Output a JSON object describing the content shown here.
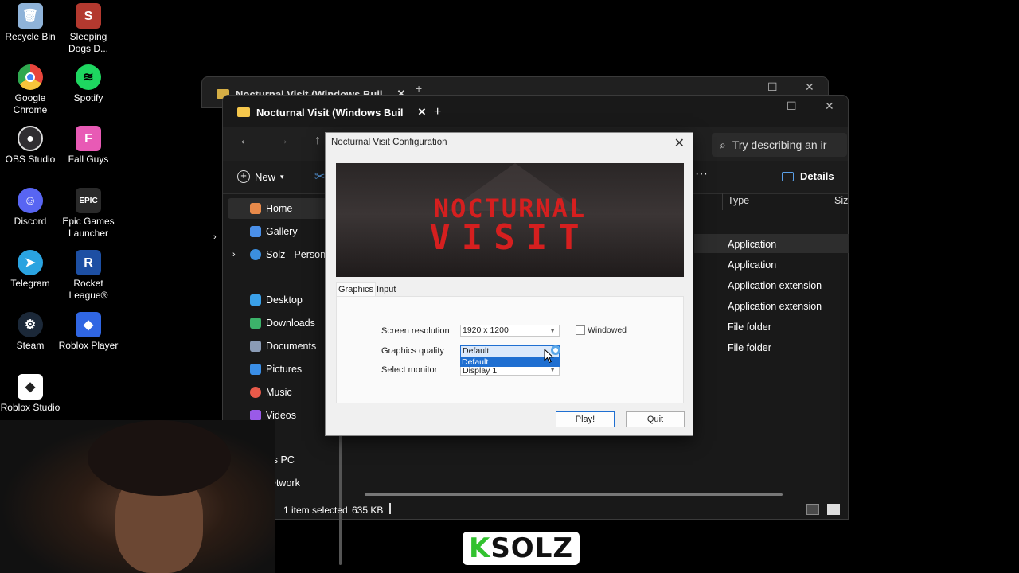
{
  "desktop": {
    "icons": [
      {
        "label": "Recycle Bin",
        "icon": "recycle-bin-icon",
        "color": "#8fb3d9"
      },
      {
        "label": "Sleeping Dogs D...",
        "icon": "sleeping-dogs-icon",
        "color": "#b3392f"
      },
      {
        "label": "Google Chrome",
        "icon": "chrome-icon",
        "color": "#e8453c"
      },
      {
        "label": "Spotify",
        "icon": "spotify-icon",
        "color": "#1ed760"
      },
      {
        "label": "OBS Studio",
        "icon": "obs-icon",
        "color": "#302e31"
      },
      {
        "label": "Fall Guys",
        "icon": "fall-guys-icon",
        "color": "#e85ab5"
      },
      {
        "label": "Discord",
        "icon": "discord-icon",
        "color": "#5865f2"
      },
      {
        "label": "Epic Games Launcher",
        "icon": "epic-games-icon",
        "color": "#2a2a2a"
      },
      {
        "label": "Telegram",
        "icon": "telegram-icon",
        "color": "#2aa3e0"
      },
      {
        "label": "Rocket League®",
        "icon": "rocket-league-icon",
        "color": "#1d4fa3"
      },
      {
        "label": "Steam",
        "icon": "steam-icon",
        "color": "#1b2838"
      },
      {
        "label": "Roblox Player",
        "icon": "roblox-player-icon",
        "color": "#3066e3"
      },
      {
        "label": "Roblox Studio",
        "icon": "roblox-studio-icon",
        "color": "#2f2f2f"
      }
    ]
  },
  "explorer": {
    "tab_title": "Nocturnal Visit (Windows Buil",
    "tab_close": "✕",
    "new_tab": "+",
    "controls": {
      "minimize": "—",
      "maximize": "☐",
      "close": "✕"
    },
    "nav": {
      "back": "←",
      "forward": "→",
      "up": "↑"
    },
    "search_placeholder": "Try describing an ir",
    "toolbar": {
      "new_label": "New",
      "details_label": "Details",
      "more": "···"
    },
    "sidebar": [
      {
        "label": "Home",
        "icon": "home-icon",
        "color": "#e88a4a"
      },
      {
        "label": "Gallery",
        "icon": "gallery-icon",
        "color": "#4a8fe8"
      },
      {
        "label": "Solz - Persona",
        "icon": "onedrive-icon",
        "color": "#3b8fe0"
      },
      {
        "label": "Desktop",
        "icon": "desktop-icon",
        "color": "#3aa0e8"
      },
      {
        "label": "Downloads",
        "icon": "downloads-icon",
        "color": "#3cb36a"
      },
      {
        "label": "Documents",
        "icon": "documents-icon",
        "color": "#8a9bb5"
      },
      {
        "label": "Pictures",
        "icon": "pictures-icon",
        "color": "#3a8ee6"
      },
      {
        "label": "Music",
        "icon": "music-icon",
        "color": "#e85a4a"
      },
      {
        "label": "Videos",
        "icon": "videos-icon",
        "color": "#9a5ae8"
      },
      {
        "label": "is PC",
        "icon": "pc-icon",
        "color": "#5aa0e8"
      },
      {
        "label": "etwork",
        "icon": "network-icon",
        "color": "#5aa0e8"
      }
    ],
    "columns": {
      "type": "Type",
      "size": "Siz"
    },
    "types": [
      "Application",
      "Application",
      "Application extension",
      "Application extension",
      "File folder",
      "File folder"
    ],
    "status": {
      "selected": "1 item selected",
      "size": "635 KB"
    }
  },
  "dialog": {
    "title": "Nocturnal Visit Configuration",
    "close": "✕",
    "banner": {
      "word1": "NOCTURNAL",
      "word2": "VISIT"
    },
    "tabs": {
      "graphics": "Graphics",
      "input": "Input"
    },
    "fields": {
      "resolution_label": "Screen resolution",
      "resolution_value": "1920 x 1200",
      "quality_label": "Graphics quality",
      "quality_value": "Default",
      "quality_option": "Default",
      "monitor_label": "Select monitor",
      "monitor_value": "Display 1"
    },
    "windowed_label": "Windowed",
    "play_label": "Play!",
    "quit_label": "Quit"
  },
  "overlay": {
    "logo_k": "K",
    "logo_rest": "SOLZ"
  }
}
